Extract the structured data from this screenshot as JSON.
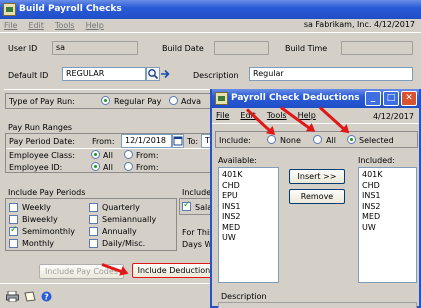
{
  "main_window": {
    "title": "Build Payroll Checks",
    "menu": [
      "File",
      "Edit",
      "Tools",
      "Help"
    ],
    "company": "sa  Fabrikam, Inc.  4/12/2017",
    "user_id_label": "User ID",
    "user_id": "sa",
    "build_date_label": "Build Date",
    "build_time_label": "Build Time",
    "default_id_label": "Default ID",
    "default_id": "REGULAR",
    "description_label": "Description",
    "description": "Regular",
    "type_of_pay_run_label": "Type of Pay Run:",
    "regular_pay": "Regular Pay",
    "advance": "Adva",
    "pay_run_ranges": "Pay Run Ranges",
    "pay_period_date": "Pay Period Date:",
    "from": "From:",
    "from_date": "12/1/2018",
    "to": "To:",
    "to_value": "T",
    "employee_class": "Employee Class:",
    "employee_id": "Employee ID:",
    "all": "All",
    "include_pay_periods": "Include Pay Periods",
    "periods": [
      "Weekly",
      "Biweekly",
      "Semimonthly",
      "Monthly",
      "Quarterly",
      "Semiannually",
      "Annually",
      "Daily/Misc."
    ],
    "include_a": "Include A",
    "sala": "Sala",
    "for_this": "For This",
    "days_w": "Days W",
    "include_pay_codes": "Include Pay Codes",
    "include_deductions": "Include Deductions"
  },
  "dialog": {
    "title": "Payroll Check Deductions",
    "menu": [
      "File",
      "Edit",
      "Tools",
      "Help"
    ],
    "date": "4/12/2017",
    "include_label": "Include:",
    "none": "None",
    "all": "All",
    "selected": "Selected",
    "available_label": "Available:",
    "included_label": "Included:",
    "available": [
      "401K",
      "CHD",
      "EPU",
      "INS1",
      "INS2",
      "MED",
      "UW"
    ],
    "included": [
      "401K",
      "CHD",
      "INS1",
      "INS2",
      "MED",
      "UW"
    ],
    "insert_button": "Insert >>",
    "remove_button": "Remove",
    "description_label": "Description"
  }
}
